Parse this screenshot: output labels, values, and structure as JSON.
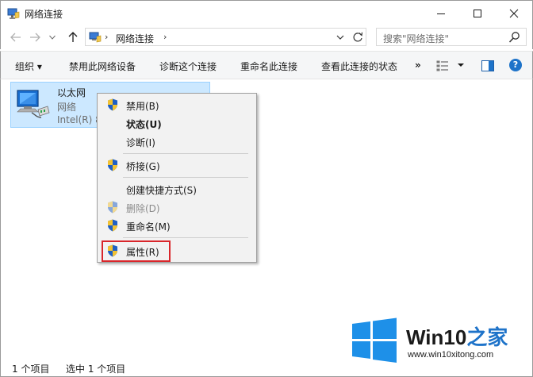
{
  "window": {
    "title": "网络连接",
    "controls": {
      "minimize": "minimize-icon",
      "maximize": "maximize-icon",
      "close": "close-icon"
    }
  },
  "address": {
    "path": "网络连接",
    "search_placeholder": "搜索\"网络连接\""
  },
  "command_bar": {
    "organize": "组织 ▾",
    "items": [
      "禁用此网络设备",
      "诊断这个连接",
      "重命名此连接",
      "查看此连接的状态"
    ],
    "more": "»"
  },
  "connection": {
    "name": "以太网",
    "status": "网络",
    "device": "Intel(R) 8"
  },
  "context_menu": {
    "items": [
      {
        "label": "禁用(B)",
        "shield": true,
        "bold": false,
        "disabled": false
      },
      {
        "label": "状态(U)",
        "shield": false,
        "bold": true,
        "disabled": false
      },
      {
        "label": "诊断(I)",
        "shield": false,
        "bold": false,
        "disabled": false
      },
      {
        "label": "桥接(G)",
        "shield": true,
        "bold": false,
        "disabled": false
      },
      {
        "label": "创建快捷方式(S)",
        "shield": false,
        "bold": false,
        "disabled": false
      },
      {
        "label": "删除(D)",
        "shield": true,
        "bold": false,
        "disabled": true
      },
      {
        "label": "重命名(M)",
        "shield": true,
        "bold": false,
        "disabled": false
      },
      {
        "label": "属性(R)",
        "shield": true,
        "bold": false,
        "disabled": false,
        "highlighted": true
      }
    ]
  },
  "status_bar": {
    "item_count": "1 个项目",
    "selected": "选中 1 个项目"
  },
  "watermark": {
    "brand": "Win10",
    "brand_zh": "之家",
    "url": "www.win10xitong.com"
  },
  "colors": {
    "selection": "#cce8ff",
    "accent": "#1e73c9",
    "highlight_border": "#d9262b"
  }
}
